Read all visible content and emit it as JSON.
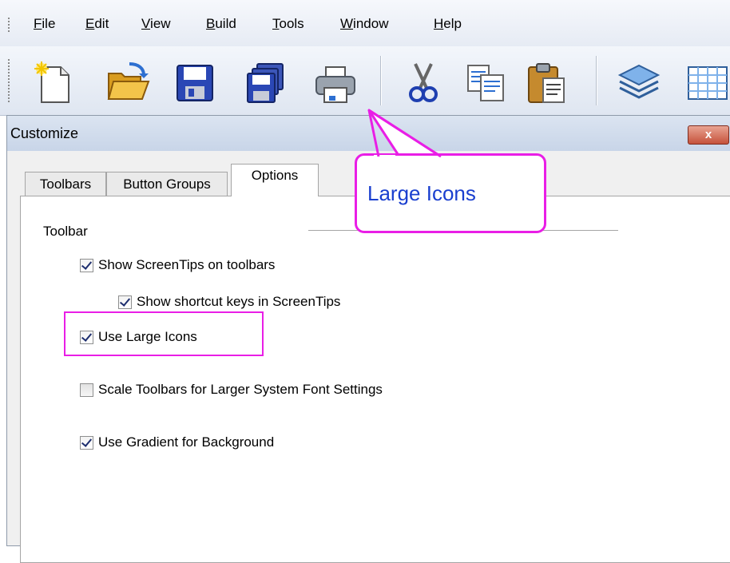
{
  "menubar": {
    "items": [
      {
        "label": "File",
        "accel": "F",
        "rest": "ile"
      },
      {
        "label": "Edit",
        "accel": "E",
        "rest": "dit"
      },
      {
        "label": "View",
        "accel": "V",
        "rest": "iew"
      },
      {
        "label": "Build",
        "accel": "B",
        "rest": "uild"
      },
      {
        "label": "Tools",
        "accel": "T",
        "rest": "ools"
      },
      {
        "label": "Window",
        "accel": "W",
        "rest": "indow"
      },
      {
        "label": "Help",
        "accel": "H",
        "rest": "elp"
      }
    ]
  },
  "toolbar": {
    "buttons": [
      "new-file-icon",
      "open-folder-icon",
      "save-icon",
      "save-all-icon",
      "print-icon",
      "cut-icon",
      "copy-icon",
      "paste-icon",
      "stack-icon",
      "grid-icon"
    ]
  },
  "dialog": {
    "title": "Customize",
    "close_label": "x",
    "tabs": [
      "Toolbars",
      "Button Groups",
      "Options"
    ],
    "active_tab": "Options",
    "group_label": "Toolbar",
    "options": [
      {
        "label": "Show ScreenTips on toolbars",
        "checked": true
      },
      {
        "label": "Show shortcut keys in ScreenTips",
        "checked": true
      },
      {
        "label": "Use Large Icons",
        "checked": true
      },
      {
        "label": "Scale Toolbars for Larger System Font Settings",
        "checked": false
      },
      {
        "label": "Use Gradient for Background",
        "checked": true
      }
    ]
  },
  "annotation": {
    "callout_text": "Large Icons",
    "color": "#e91ee6",
    "text_color": "#1a3fcf"
  }
}
